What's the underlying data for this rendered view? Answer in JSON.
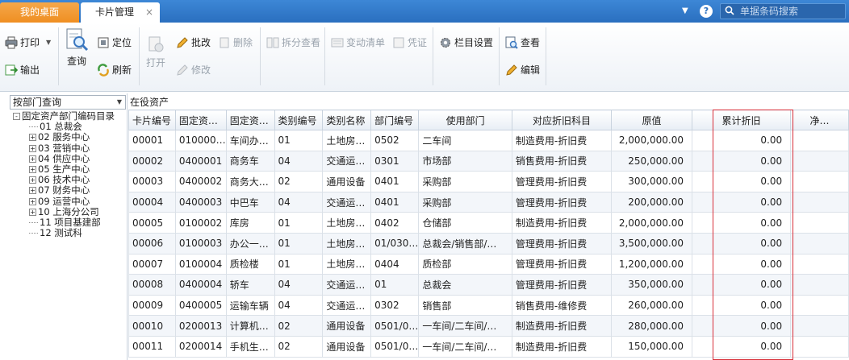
{
  "tabs": {
    "home": "我的桌面",
    "active": "卡片管理",
    "close_glyph": "×"
  },
  "topbar": {
    "dropdown_glyph": "▼",
    "help_glyph": "?",
    "search_placeholder": "单据条码搜索"
  },
  "toolbar": {
    "print": "打印",
    "export": "输出",
    "query": "查询",
    "locate": "定位",
    "refresh": "刷新",
    "open": "打开",
    "batch_edit": "批改",
    "delete": "删除",
    "modify": "修改",
    "split_view": "拆分查看",
    "change_list": "变动清单",
    "voucher": "凭证",
    "column_settings": "栏目设置",
    "view": "查看",
    "edit": "编辑"
  },
  "left_panel": {
    "select_value": "按部门查询",
    "tree": [
      {
        "label": "固定资产部门编码目录",
        "level": 0,
        "expander": "-"
      },
      {
        "label": "01 总裁会",
        "level": 1,
        "expander": ""
      },
      {
        "label": "02 服务中心",
        "level": 1,
        "expander": "+"
      },
      {
        "label": "03 营销中心",
        "level": 1,
        "expander": "+"
      },
      {
        "label": "04 供应中心",
        "level": 1,
        "expander": "+"
      },
      {
        "label": "05 生产中心",
        "level": 1,
        "expander": "+"
      },
      {
        "label": "06 技术中心",
        "level": 1,
        "expander": "+"
      },
      {
        "label": "07 财务中心",
        "level": 1,
        "expander": "+"
      },
      {
        "label": "09 运营中心",
        "level": 1,
        "expander": "+"
      },
      {
        "label": "10 上海分公司",
        "level": 1,
        "expander": "+"
      },
      {
        "label": "11 项目基建部",
        "level": 1,
        "expander": ""
      },
      {
        "label": "12 测试科",
        "level": 1,
        "expander": ""
      }
    ]
  },
  "main": {
    "title": "在役资产",
    "columns": [
      "卡片编号",
      "固定资…",
      "固定资…",
      "类别编号",
      "类别名称",
      "部门编号",
      "使用部门",
      "对应折旧科目",
      "原值",
      "累计折旧",
      "净…"
    ],
    "rows": [
      [
        "00001",
        "010000…",
        "车间办…",
        "01",
        "土地房…",
        "0502",
        "二车间",
        "制造费用-折旧费",
        "2,000,000.00",
        "0.00",
        ""
      ],
      [
        "00002",
        "0400001",
        "商务车",
        "04",
        "交通运…",
        "0301",
        "市场部",
        "销售费用-折旧费",
        "250,000.00",
        "0.00",
        ""
      ],
      [
        "00003",
        "0400002",
        "商务大…",
        "02",
        "通用设备",
        "0401",
        "采购部",
        "管理费用-折旧费",
        "300,000.00",
        "0.00",
        ""
      ],
      [
        "00004",
        "0400003",
        "中巴车",
        "04",
        "交通运…",
        "0401",
        "采购部",
        "管理费用-折旧费",
        "200,000.00",
        "0.00",
        ""
      ],
      [
        "00005",
        "0100002",
        "库房",
        "01",
        "土地房…",
        "0402",
        "仓储部",
        "制造费用-折旧费",
        "2,000,000.00",
        "0.00",
        ""
      ],
      [
        "00006",
        "0100003",
        "办公一…",
        "01",
        "土地房…",
        "01/030…",
        "总裁会/销售部/…",
        "管理费用-折旧费",
        "3,500,000.00",
        "0.00",
        ""
      ],
      [
        "00007",
        "0100004",
        "质检楼",
        "01",
        "土地房…",
        "0404",
        "质检部",
        "管理费用-折旧费",
        "1,200,000.00",
        "0.00",
        ""
      ],
      [
        "00008",
        "0400004",
        "轿车",
        "04",
        "交通运…",
        "01",
        "总裁会",
        "管理费用-折旧费",
        "350,000.00",
        "0.00",
        ""
      ],
      [
        "00009",
        "0400005",
        "运输车辆",
        "04",
        "交通运…",
        "0302",
        "销售部",
        "销售费用-维修费",
        "260,000.00",
        "0.00",
        ""
      ],
      [
        "00010",
        "0200013",
        "计算机…",
        "02",
        "通用设备",
        "0501/0…",
        "一车间/二车间/…",
        "制造费用-折旧费",
        "280,000.00",
        "0.00",
        ""
      ],
      [
        "00011",
        "0200014",
        "手机生…",
        "02",
        "通用设备",
        "0501/0…",
        "一车间/二车间/…",
        "制造费用-折旧费",
        "150,000.00",
        "0.00",
        ""
      ]
    ]
  },
  "colors": {
    "tabbar_blue": "#2a6fbf",
    "home_tab_orange": "#ef8f22",
    "highlight_red": "#d8303a"
  },
  "icons": [
    "close-icon",
    "chevron-down-icon",
    "help-icon",
    "search-icon",
    "printer-icon",
    "export-icon",
    "query-icon",
    "locate-icon",
    "refresh-icon",
    "open-icon",
    "batch-edit-icon",
    "delete-icon",
    "modify-icon",
    "split-view-icon",
    "change-list-icon",
    "voucher-icon",
    "gear-icon",
    "view-icon",
    "edit-icon"
  ]
}
